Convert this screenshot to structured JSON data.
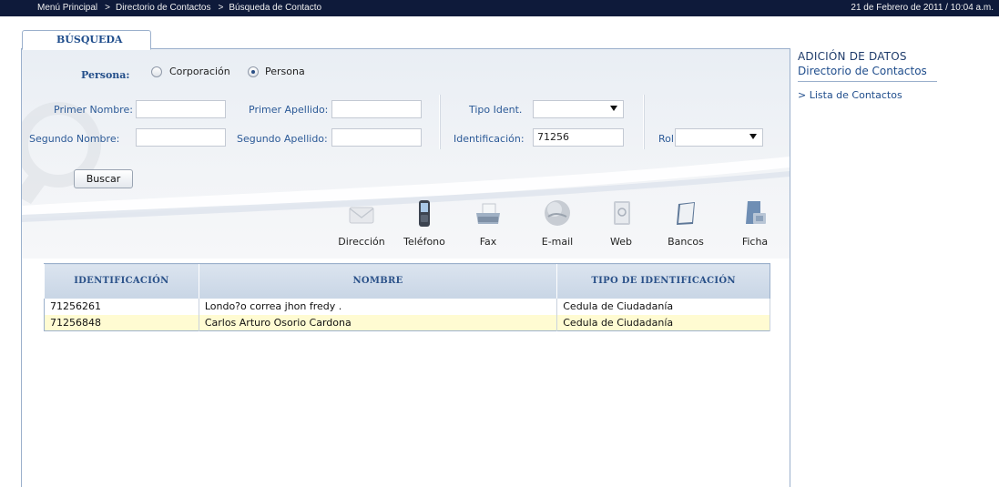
{
  "breadcrumb": [
    {
      "label": "Menú Principal"
    },
    {
      "label": "Directorio de Contactos"
    },
    {
      "label": "Búsqueda de Contacto"
    }
  ],
  "breadcrumb_separator": ">",
  "datetime": "21 de Febrero de 2011 / 10:04 a.m.",
  "tab": {
    "label": "BÚSQUEDA"
  },
  "search": {
    "persona_label": "Persona:",
    "radio_corporacion": "Corporación",
    "radio_persona": "Persona",
    "selected_radio": "Persona",
    "primer_nombre_label": "Primer Nombre:",
    "primer_nombre_value": "",
    "segundo_nombre_label": "Segundo Nombre:",
    "segundo_nombre_value": "",
    "primer_apellido_label": "Primer Apellido:",
    "primer_apellido_value": "",
    "segundo_apellido_label": "Segundo Apellido:",
    "segundo_apellido_value": "",
    "tipo_ident_label": "Tipo Ident.",
    "tipo_ident_value": "",
    "identificacion_label": "Identificación:",
    "identificacion_value": "71256",
    "rol_label": "Rol:",
    "rol_value": "",
    "buscar_label": "Buscar"
  },
  "toolbar": [
    {
      "label": "Dirección",
      "icon": "envelope-icon"
    },
    {
      "label": "Teléfono",
      "icon": "phone-icon"
    },
    {
      "label": "Fax",
      "icon": "fax-icon"
    },
    {
      "label": "E-mail",
      "icon": "globe-icon"
    },
    {
      "label": "Web",
      "icon": "web-book-icon"
    },
    {
      "label": "Bancos",
      "icon": "notebook-icon"
    },
    {
      "label": "Ficha",
      "icon": "folder-icon"
    }
  ],
  "results": {
    "columns": [
      "IDENTIFICACIÓN",
      "NOMBRE",
      "TIPO DE IDENTIFICACIÓN"
    ],
    "rows": [
      {
        "id": "71256261",
        "nombre": "Londo?o correa jhon fredy .",
        "tipo": "Cedula de Ciudadanía"
      },
      {
        "id": "71256848",
        "nombre": "Carlos Arturo Osorio Cardona",
        "tipo": "Cedula de Ciudadanía"
      }
    ]
  },
  "sidebar": {
    "title1": "ADICIÓN DE DATOS",
    "title2": "Directorio de Contactos",
    "link": "> Lista de Contactos"
  },
  "colors": {
    "topbar": "#0e1a3a",
    "accent": "#1f4d8c",
    "row_highlight": "#fffbd2"
  }
}
